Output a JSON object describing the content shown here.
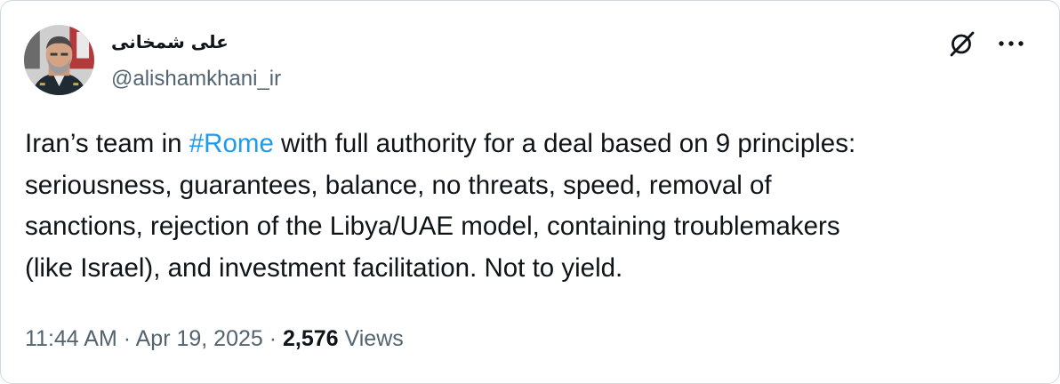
{
  "tweet": {
    "author": {
      "display_name": "علی شمخانی",
      "handle": "@alishamkhani_ir"
    },
    "icons": {
      "grok": "grok-slash-icon",
      "more": "more-horizontal-icon"
    },
    "text": {
      "line1_pre": "Iran’s team in ",
      "hashtag": "#Rome",
      "line1_post": " with full authority for a deal based on 9 principles:",
      "line2": "seriousness, guarantees, balance, no threats, speed, removal of",
      "line3": "sanctions, rejection of the Libya/UAE model, containing troublemakers",
      "line4": "(like Israel), and investment facilitation. Not to yield."
    },
    "meta": {
      "time": "11:44 AM",
      "sep1": " · ",
      "date": "Apr 19, 2025",
      "sep2": " · ",
      "views_count": "2,576",
      "views_label": " Views"
    },
    "colors": {
      "link": "#1d9bf0",
      "secondary": "#536471",
      "primary": "#0f1419"
    }
  }
}
